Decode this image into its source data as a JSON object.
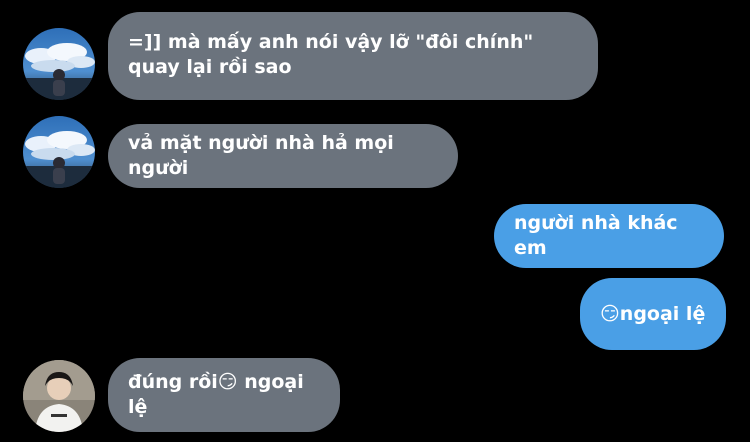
{
  "messages": [
    {
      "sender": "other",
      "text": "=]] mà mấy anh nói vậy lỡ \"đôi chính\" quay lại rồi sao"
    },
    {
      "sender": "other",
      "text": "vả mặt người nhà hả mọi người"
    },
    {
      "sender": "me",
      "text": "người nhà khác em"
    },
    {
      "sender": "me",
      "text": "😏ngoại lệ"
    },
    {
      "sender": "other2",
      "text": "đúng rồi😏 ngoại lệ"
    }
  ],
  "colors": {
    "background": "#000000",
    "incoming_bubble": "#6b737d",
    "outgoing_bubble": "#4a9fe6",
    "text": "#ffffff"
  }
}
